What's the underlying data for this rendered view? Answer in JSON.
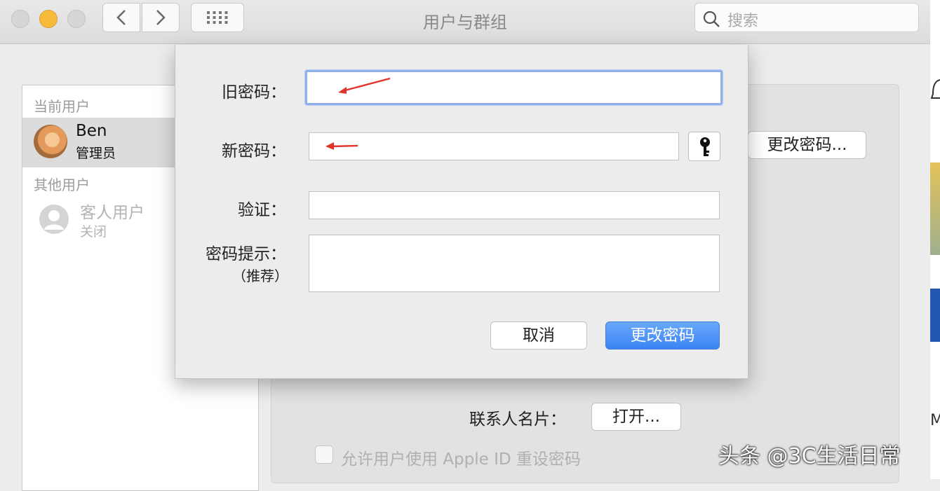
{
  "window": {
    "title": "用户与群组"
  },
  "search": {
    "placeholder": "搜索"
  },
  "sidebar": {
    "current_users_label": "当前用户",
    "current_user": {
      "name": "Ben",
      "role": "管理员"
    },
    "other_users_label": "其他用户",
    "guest_user": {
      "name": "客人用户",
      "status": "关闭"
    }
  },
  "panel": {
    "change_password_button": "更改密码...",
    "contact_card_label": "联系人名片：",
    "open_button": "打开...",
    "allow_apple_id_reset_label": "允许用户使用 Apple ID 重设密码"
  },
  "dialog": {
    "old_password_label": "旧密码：",
    "new_password_label": "新密码：",
    "verify_label": "验证：",
    "hint_label": "密码提示：",
    "hint_sublabel": "（推荐）",
    "old_password_value": "",
    "new_password_value": "",
    "verify_value": "",
    "hint_value": "",
    "cancel_button": "取消",
    "confirm_button": "更改密码"
  },
  "annotation_color": "#e0342a",
  "accent_color": "#3b84f3",
  "watermark": "头条 @3C生活日常",
  "icons": [
    "search-icon",
    "chevron-left-icon",
    "chevron-right-icon",
    "grid-icon",
    "key-icon",
    "bell-icon",
    "person-icon"
  ]
}
